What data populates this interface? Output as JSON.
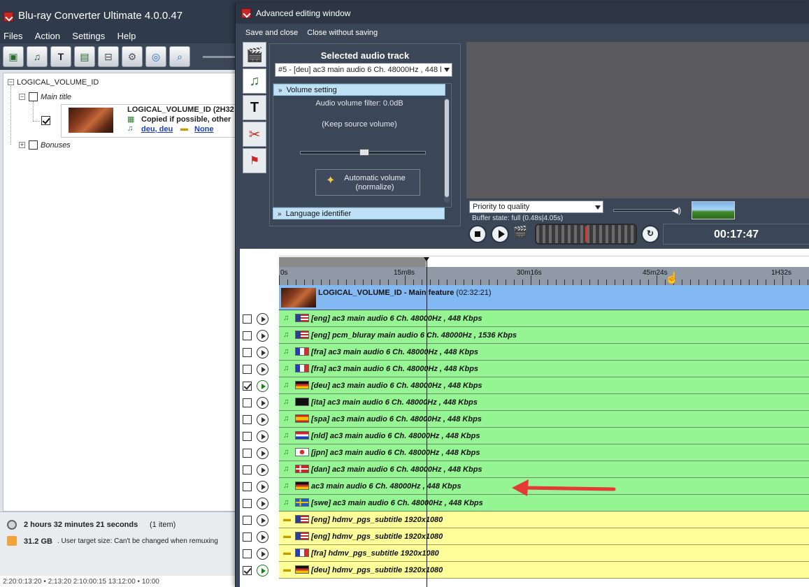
{
  "main": {
    "title": "Blu-ray Converter Ultimate 4.0.0.47",
    "menu": [
      "Files",
      "Action",
      "Settings",
      "Help"
    ],
    "tree": {
      "root": "LOGICAL_VOLUME_ID",
      "main_title": "Main title",
      "item_title": "LOGICAL_VOLUME_ID (2H32",
      "item_sub": "Copied if possible, other",
      "audio_links": "deu, deu",
      "subtitle_link": "None",
      "bonuses": "Bonuses"
    },
    "status": {
      "duration": "2 hours 32 minutes 21 seconds",
      "count": "(1 item)",
      "size": "31.2 GB",
      "size_note": ". User target size: Can't be changed when remuxing"
    },
    "bottom_strip": "2:20:0:13:20 • 2:13:20     2:10:00:15 13:12:00 • 10:00"
  },
  "adv": {
    "title": "Advanced editing window",
    "menu": [
      "Save and close",
      "Close without saving"
    ],
    "panel_title": "Selected audio track",
    "selected_track": "#5 - [deu] ac3 main audio 6 Ch. 48000Hz , 448 l",
    "volume_section": "Volume setting",
    "volume_filter": "Audio volume filter: 0.0dB",
    "keep_source": "(Keep source volume)",
    "auto_volume_line1": "Automatic volume",
    "auto_volume_line2": "(normalize)",
    "language_section": "Language identifier",
    "priority": "Priority to quality",
    "buffer": "Buffer state: full (0.48s|4.05s)",
    "time": "00:17:47",
    "ruler_labels": [
      "0s",
      "15m8s",
      "30m16s",
      "45m24s",
      "1H32s"
    ],
    "feature_title": "LOGICAL_VOLUME_ID - Main feature",
    "feature_duration": "(02:32:21)",
    "tracks": [
      {
        "kind": "audio",
        "checked": false,
        "flag": "us",
        "label": "[eng] ac3 main audio 6 Ch. 48000Hz , 448 Kbps"
      },
      {
        "kind": "audio",
        "checked": false,
        "flag": "us",
        "label": "[eng] pcm_bluray main audio 6 Ch. 48000Hz , 1536 Kbps"
      },
      {
        "kind": "audio",
        "checked": false,
        "flag": "fr",
        "label": "[fra] ac3 main audio 6 Ch. 48000Hz , 448 Kbps"
      },
      {
        "kind": "audio",
        "checked": false,
        "flag": "fr",
        "label": "[fra] ac3 main audio 6 Ch. 48000Hz , 448 Kbps"
      },
      {
        "kind": "audio",
        "checked": true,
        "flag": "de",
        "label": "[deu] ac3 main audio 6 Ch. 48000Hz , 448 Kbps"
      },
      {
        "kind": "audio",
        "checked": false,
        "flag": "black",
        "label": "[ita] ac3 main audio 6 Ch. 48000Hz , 448 Kbps"
      },
      {
        "kind": "audio",
        "checked": false,
        "flag": "es",
        "label": "[spa] ac3 main audio 6 Ch. 48000Hz , 448 Kbps"
      },
      {
        "kind": "audio",
        "checked": false,
        "flag": "nl",
        "label": "[nld] ac3 main audio 6 Ch. 48000Hz , 448 Kbps"
      },
      {
        "kind": "audio",
        "checked": false,
        "flag": "jp",
        "label": "[jpn] ac3 main audio 6 Ch. 48000Hz , 448 Kbps"
      },
      {
        "kind": "audio",
        "checked": false,
        "flag": "dk",
        "label": "[dan] ac3 main audio 6 Ch. 48000Hz , 448 Kbps"
      },
      {
        "kind": "audio",
        "checked": false,
        "flag": "de",
        "label": "ac3 main audio 6 Ch. 48000Hz , 448 Kbps"
      },
      {
        "kind": "audio",
        "checked": false,
        "flag": "se",
        "label": "[swe] ac3 main audio 6 Ch. 48000Hz , 448 Kbps"
      },
      {
        "kind": "subtitle",
        "checked": false,
        "flag": "us",
        "label": "[eng] hdmv_pgs_subtitle 1920x1080"
      },
      {
        "kind": "subtitle",
        "checked": false,
        "flag": "us",
        "label": "[eng] hdmv_pgs_subtitle 1920x1080"
      },
      {
        "kind": "subtitle",
        "checked": false,
        "flag": "fr",
        "label": "[fra] hdmv_pgs_subtitle 1920x1080"
      },
      {
        "kind": "subtitle",
        "checked": true,
        "flag": "de",
        "label": "[deu] hdmv_pgs_subtitle 1920x1080"
      }
    ]
  },
  "colors": {
    "audio_row": "#95f593",
    "subtitle_row": "#ffff99",
    "feature_row": "#82b9f3",
    "arrow": "#e53935"
  }
}
